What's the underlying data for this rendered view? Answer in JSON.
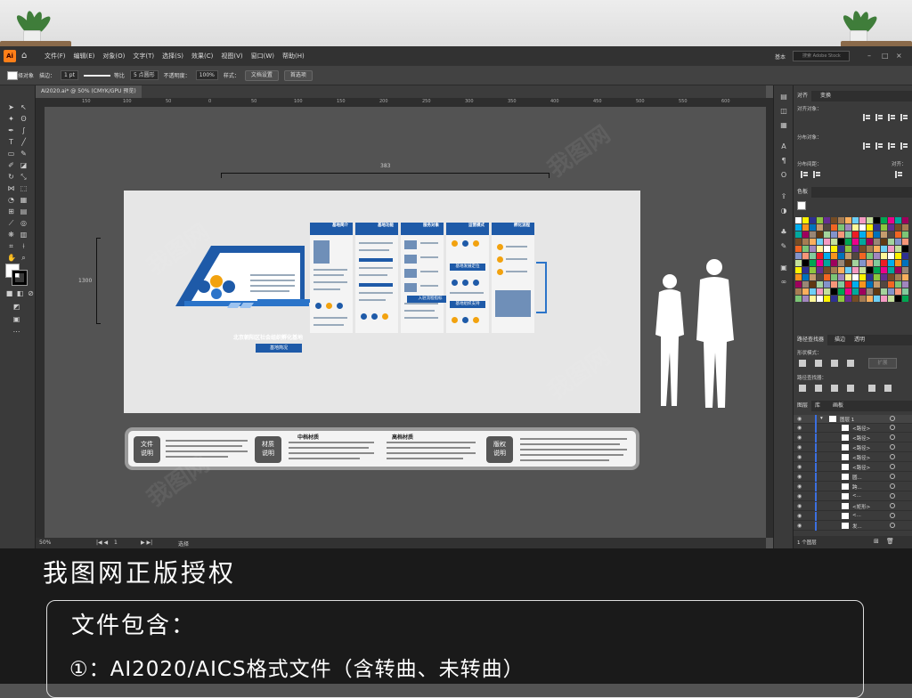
{
  "app": {
    "logo": "Ai",
    "menu": [
      "文件(F)",
      "编辑(E)",
      "对象(O)",
      "文字(T)",
      "选择(S)",
      "效果(C)",
      "视图(V)",
      "窗口(W)",
      "帮助(H)"
    ],
    "workspace": "基本",
    "search_placeholder": "搜索 Adobe Stock"
  },
  "controlbar": {
    "no_selection": "未选择对象",
    "stroke_label": "描边：",
    "stroke_value": "1 pt",
    "stroke_style": "等比",
    "brush": "5 点圆形",
    "opacity_label": "不透明度：",
    "opacity_value": "100%",
    "style_label": "样式：",
    "doc_setup": "文档设置",
    "prefs": "首选项"
  },
  "document": {
    "tab": "AI2020.ai* @ 50% (CMYK/GPU 预览)",
    "ruler_marks": [
      "150",
      "100",
      "50",
      "0",
      "50",
      "100",
      "150",
      "200",
      "250",
      "300",
      "350",
      "400",
      "450",
      "500",
      "550",
      "600"
    ]
  },
  "artboard": {
    "width_dim": "383",
    "height_dim": "1300",
    "banner_title": "北京朝阳区社会组织孵化基地",
    "banner_sub": "基地简况",
    "panels": [
      {
        "head": "基地简介"
      },
      {
        "head": "基地功能"
      },
      {
        "head": "服务对象"
      },
      {
        "head": "运营模式"
      },
      {
        "head": "孵化流程"
      }
    ],
    "mid_labels": [
      "基地发展定位",
      "入驻流程指标",
      "基地组织支持"
    ]
  },
  "infobar": {
    "file_label": "文件\n说明",
    "material_label": "材质\n说明",
    "copyright_label": "版权\n说明",
    "mid_title": "中档材质",
    "high_title": "高档材质"
  },
  "statusbar": {
    "zoom": "50%",
    "page": "1",
    "tool": "选择"
  },
  "panels": {
    "align_tab": "对齐",
    "transform_tab": "变换",
    "align_objects": "对齐对象：",
    "distribute_objects": "分布对象：",
    "distribute_spacing": "分布间距：",
    "align_to": "对齐：",
    "swatches_tab": "色板",
    "pathfinder_tab": "路径查找器",
    "stroke_tab": "描边",
    "transparency_tab": "透明",
    "shape_modes": "形状模式：",
    "pathfinders": "路径查找器：",
    "expand": "扩展",
    "layers_tab": "图层",
    "library_tab": "库",
    "artboards_tab": "画板",
    "layer_name": "图层 1",
    "layer_rows": [
      "<路径>",
      "<路径>",
      "<路径>",
      "<路径>",
      "<路径>",
      "圆...",
      "跨...",
      "<...",
      "<矩形>",
      "<...",
      "发..."
    ],
    "layer_count": "1 个图层"
  },
  "footer": {
    "title": "我图网正版授权",
    "contains": "文件包含：",
    "item1": "①：AI2020/AICS格式文件（含转曲、未转曲）"
  },
  "watermark": "我图网",
  "colors": {
    "accent": "#1e5aa8",
    "ai_orange": "#ff7f18"
  }
}
